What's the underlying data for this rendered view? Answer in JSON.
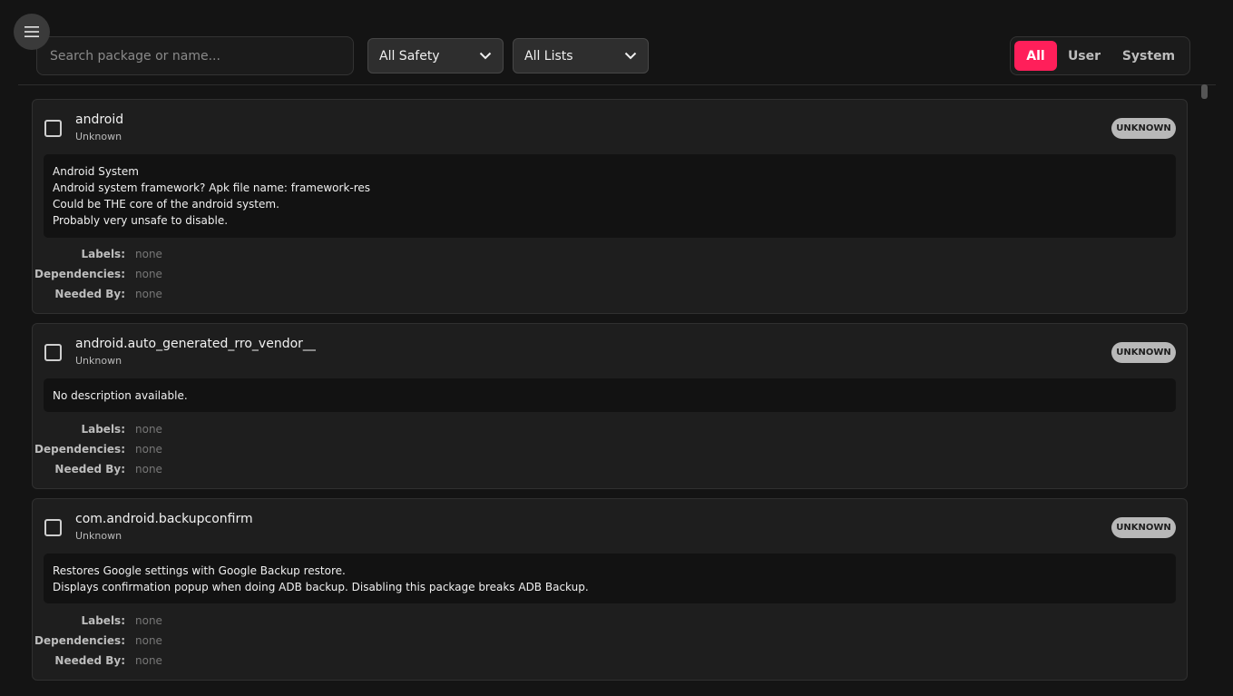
{
  "header": {
    "search_placeholder": "Search package or name...",
    "safety_select": "All Safety",
    "lists_select": "All Lists",
    "filters": [
      "All",
      "User",
      "System"
    ]
  },
  "meta_labels": {
    "labels": "Labels:",
    "dependencies": "Dependencies:",
    "needed_by": "Needed By:"
  },
  "packages": [
    {
      "name": "android",
      "subtitle": "Unknown",
      "badge": "UNKNOWN",
      "description": [
        "Android System",
        "Android system framework? Apk file name: framework-res",
        "Could be THE core of the android system.",
        "Probably very unsafe to disable."
      ],
      "labels": "none",
      "dependencies": "none",
      "needed_by": "none"
    },
    {
      "name": "android.auto_generated_rro_vendor__",
      "subtitle": "Unknown",
      "badge": "UNKNOWN",
      "description": [
        "No description available."
      ],
      "labels": "none",
      "dependencies": "none",
      "needed_by": "none"
    },
    {
      "name": "com.android.backupconfirm",
      "subtitle": "Unknown",
      "badge": "UNKNOWN",
      "description": [
        "Restores Google settings with Google Backup restore.",
        "Displays confirmation popup when doing ADB backup. Disabling this package breaks ADB Backup."
      ],
      "labels": "none",
      "dependencies": "none",
      "needed_by": "none"
    }
  ],
  "colors": {
    "accent": "#ff1f5a",
    "background": "#141414",
    "card": "#1e1e1e"
  }
}
